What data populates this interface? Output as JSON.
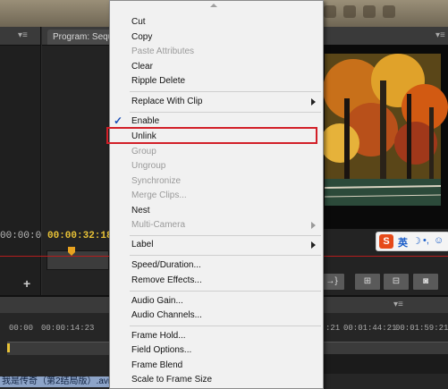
{
  "left_panel": {
    "menu_glyph": "▾≡",
    "timecode": "00:00:00"
  },
  "program": {
    "tab_label": "Program: Seque",
    "menu_glyph": "▾≡",
    "timecode": "00:00:32:18",
    "buttons": [
      {
        "label": "→}"
      },
      {
        "label": "⊞"
      },
      {
        "label": "⊟"
      },
      {
        "label": "◙"
      }
    ],
    "add_label": "+"
  },
  "ime": {
    "logo": "S",
    "lang": "英",
    "moon": "☽",
    "punct": "•,",
    "face": "☺"
  },
  "timeline": {
    "menu_glyph": "▾≡",
    "ruler_ticks": [
      {
        "label": "00:00"
      },
      {
        "label": "00:00:14:23"
      },
      {
        "label": ":21"
      },
      {
        "label": "00:01:44:21"
      },
      {
        "label": "00:01:59:21"
      }
    ],
    "clip_label": "我是传奇（第2结局版）.avi"
  },
  "menu": {
    "items": [
      {
        "label": "Cut",
        "disabled": false
      },
      {
        "label": "Copy",
        "disabled": false
      },
      {
        "label": "Paste Attributes",
        "disabled": true
      },
      {
        "label": "Clear",
        "disabled": false
      },
      {
        "label": "Ripple Delete",
        "disabled": false
      },
      {
        "label": "Replace With Clip",
        "disabled": false,
        "submenu": true
      },
      {
        "label": "Enable",
        "disabled": false,
        "checked": true
      },
      {
        "label": "Unlink",
        "disabled": false
      },
      {
        "label": "Group",
        "disabled": true
      },
      {
        "label": "Ungroup",
        "disabled": true
      },
      {
        "label": "Synchronize",
        "disabled": true
      },
      {
        "label": "Merge Clips...",
        "disabled": true
      },
      {
        "label": "Nest",
        "disabled": false
      },
      {
        "label": "Multi-Camera",
        "disabled": true,
        "submenu": true
      },
      {
        "label": "Label",
        "disabled": false,
        "submenu": true
      },
      {
        "label": "Speed/Duration...",
        "disabled": false
      },
      {
        "label": "Remove Effects...",
        "disabled": false
      },
      {
        "label": "Audio Gain...",
        "disabled": false
      },
      {
        "label": "Audio Channels...",
        "disabled": false
      },
      {
        "label": "Frame Hold...",
        "disabled": false
      },
      {
        "label": "Field Options...",
        "disabled": false
      },
      {
        "label": "Frame Blend",
        "disabled": false
      },
      {
        "label": "Scale to Frame Size",
        "disabled": false
      }
    ],
    "highlighted_item": "Unlink",
    "highlight_color": "#d21f28",
    "check_mark": "✓"
  }
}
